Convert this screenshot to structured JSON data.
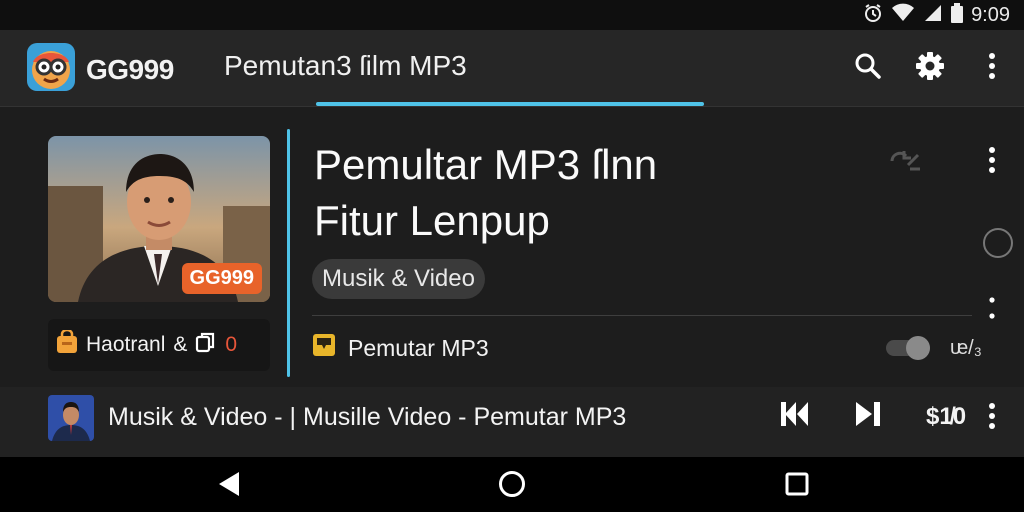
{
  "status_bar": {
    "time": "9:09",
    "icons": [
      "alarm-icon",
      "wifi-icon",
      "cellular-signal-icon",
      "battery-icon"
    ]
  },
  "app_bar": {
    "brand_name": "GG999",
    "title": "Pemutan3 ſilm MP3",
    "actions": [
      "search-icon",
      "gear-icon",
      "more-vertical-icon"
    ]
  },
  "hero": {
    "cover_badge": "GG999",
    "headline_line1": "Pemultar MP3 ſlnn",
    "headline_line2": "Fitur Lenpup",
    "category_chip": "Musik & Video",
    "meta": {
      "label": "Haotranl",
      "amp": "&",
      "count": "0"
    },
    "row": {
      "label": "Pemutar MP3",
      "toggle_on": false,
      "right_label": "ᵫ/₃"
    }
  },
  "player": {
    "now_playing": "Musik & Video - |  Musille Video - Pemutar MP3",
    "speed_label": "$1̸0"
  },
  "colors": {
    "accent": "#4fc3e8",
    "badge": "#e8632a",
    "count": "#e8563a",
    "background": "#1b1b1b",
    "app_bar": "#262626"
  }
}
